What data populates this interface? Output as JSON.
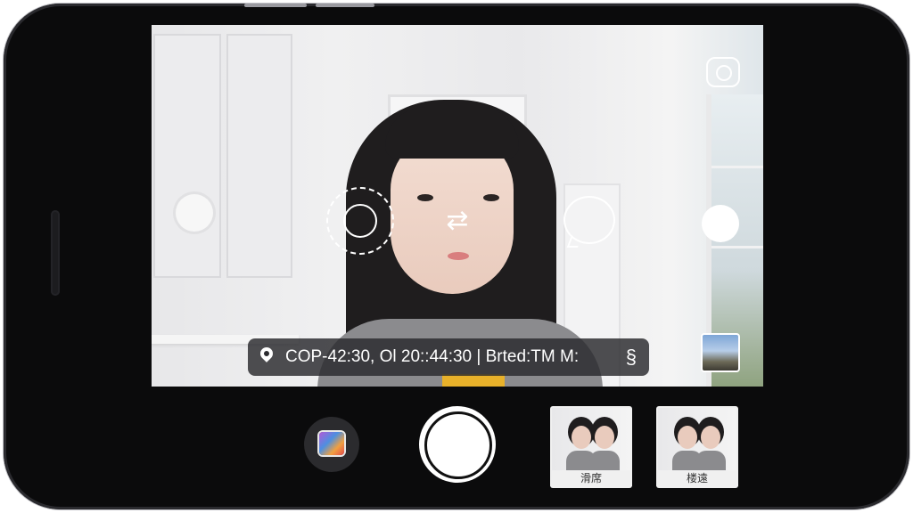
{
  "camera": {
    "info_text": "COP-42:30, Ol 20::44:30 | Brted:TM M:",
    "info_trailing_glyph": "§",
    "icons": {
      "location": "location-pin-icon",
      "face_tracking": "face-tracking-icon",
      "focus_ring": "focus-ring-icon",
      "flip": "flip-camera-icon",
      "speech": "speech-bubble-icon",
      "record": "record-dot-icon"
    }
  },
  "bottom_bar": {
    "gallery_icon": "gallery-icon",
    "shutter_icon": "shutter-button",
    "previews": [
      {
        "label": "滑席"
      },
      {
        "label": "楼遠"
      }
    ]
  },
  "colors": {
    "bezel": "#0b0b0c",
    "info_bar": "#28282c",
    "accent_white": "#ffffff"
  }
}
